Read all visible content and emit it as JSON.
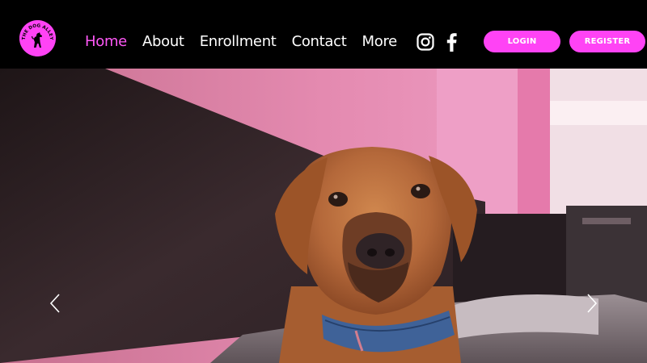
{
  "logo": {
    "text": "THE DOG ALLEY",
    "icon": "dog-silhouette-icon",
    "background": "#ff43f5"
  },
  "nav": {
    "items": [
      {
        "label": "Home",
        "active": true
      },
      {
        "label": "About",
        "active": false
      },
      {
        "label": "Enrollment",
        "active": false
      },
      {
        "label": "Contact",
        "active": false
      },
      {
        "label": "More",
        "active": false
      }
    ],
    "active_color": "#ff58f7",
    "text_color": "#ffffff"
  },
  "social": {
    "icons": [
      "instagram-icon",
      "facebook-icon"
    ]
  },
  "buttons": {
    "login_label": "LOGIN",
    "register_label": "REGISTER",
    "color": "#ff43f5"
  },
  "slideshow": {
    "image": "dog-photo",
    "prev_icon": "chevron-left-icon",
    "next_icon": "chevron-right-icon"
  }
}
